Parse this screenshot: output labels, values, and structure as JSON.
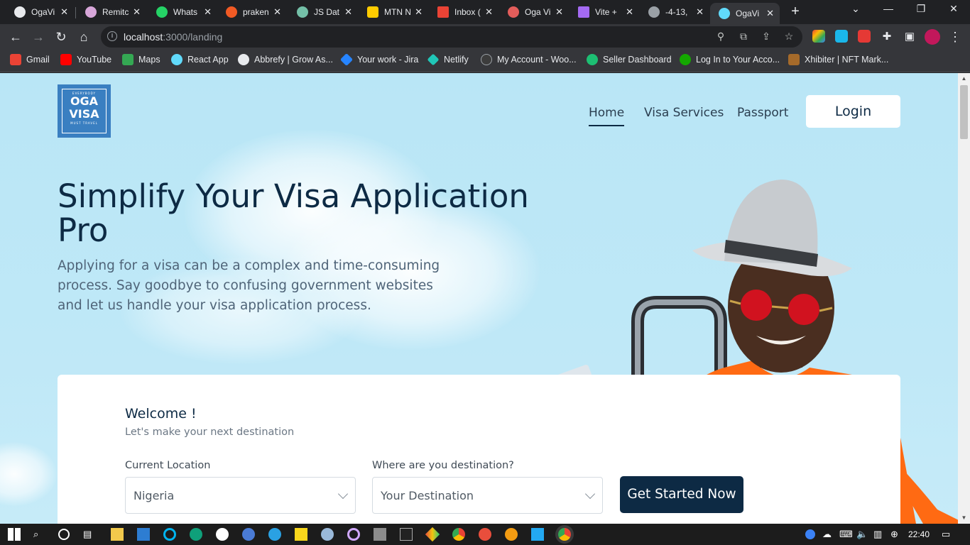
{
  "browser": {
    "tabs": [
      {
        "label": "OgaVi",
        "color": "#e8eaed"
      },
      {
        "label": "Remitc",
        "color": "#d7a6d9"
      },
      {
        "label": "Whats",
        "color": "#25d366"
      },
      {
        "label": "praken",
        "color": "#f15a24"
      },
      {
        "label": "JS Dat",
        "color": "#74c0a8"
      },
      {
        "label": "MTN N",
        "color": "#ffcc00"
      },
      {
        "label": "Inbox (",
        "color": "#ea4335"
      },
      {
        "label": "Oga Vi",
        "color": "#e35d5b"
      },
      {
        "label": "Vite +",
        "color": "#a46af2"
      },
      {
        "label": "-4-13,",
        "color": "#9aa0a6"
      },
      {
        "label": "OgaVi",
        "color": "#61dafb"
      }
    ],
    "active_tab": 10,
    "url_host": "localhost",
    "url_path": ":3000/landing",
    "bookmarks": [
      {
        "label": "Gmail",
        "color": "#ea4335"
      },
      {
        "label": "YouTube",
        "color": "#ff0000"
      },
      {
        "label": "Maps",
        "color": "#34a853"
      },
      {
        "label": "React App",
        "color": "#61dafb"
      },
      {
        "label": "Abbrefy | Grow As...",
        "color": "#e8eaed"
      },
      {
        "label": "Your work - Jira",
        "color": "#2684ff"
      },
      {
        "label": "Netlify",
        "color": "#20c6b7"
      },
      {
        "label": "My Account - Woo...",
        "color": "#3c3c3c"
      },
      {
        "label": "Seller Dashboard",
        "color": "#1dbf73"
      },
      {
        "label": "Log In to Your Acco...",
        "color": "#14a800"
      },
      {
        "label": "Xhibiter | NFT Mark...",
        "color": "#a56a2a"
      }
    ]
  },
  "site": {
    "logo": {
      "small_top": "EVERYBODY",
      "word1": "OGA",
      "word2": "VISA",
      "small_bottom": "MUST TRAVEL"
    },
    "nav": {
      "home": "Home",
      "visa_services": "Visa Services",
      "passport": "Passport",
      "login": "Login"
    },
    "hero": {
      "title": "Simplify Your Visa Application Pro",
      "subtitle": "Applying for a visa can be a complex and time-consuming process. Say goodbye to confusing government websites and let us handle your visa application process."
    },
    "form": {
      "welcome": "Welcome !",
      "welcome_sub": "Let's make your next destination",
      "location_label": "Current Location",
      "location_value": "Nigeria",
      "destination_label": "Where are you destination?",
      "destination_placeholder": "Your Destination",
      "cta": "Get Started Now"
    }
  },
  "taskbar": {
    "time": "22:40"
  },
  "colors": {
    "brand_navy": "#0d2a44",
    "hero_bg": "#bfe8f7",
    "logo_blue": "#3a7fc1"
  }
}
